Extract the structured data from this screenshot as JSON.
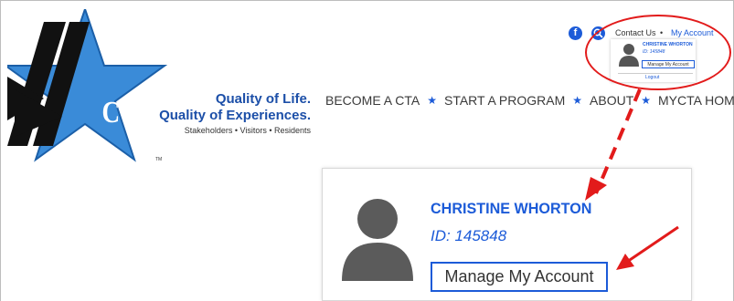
{
  "logo": {
    "text": "CTA",
    "tm": "TM",
    "tagline_line1": "Quality of Life.",
    "tagline_line2": "Quality of Experiences.",
    "tagline_line3": "Stakeholders • Visitors • Residents"
  },
  "nav": {
    "items": [
      "BECOME A CTA",
      "START A PROGRAM",
      "ABOUT",
      "MYCTA HOME"
    ],
    "separator": "★"
  },
  "social": {
    "facebook_icon": "facebook-icon",
    "search_icon": "search-icon"
  },
  "top_links": {
    "contact": "Contact Us",
    "separator": "•",
    "my_account": "My Account"
  },
  "account": {
    "name": "CHRISTINE WHORTON",
    "id": "ID: 145848",
    "manage_label": "Manage My Account",
    "logout_label": "Logout"
  },
  "colors": {
    "brand_blue": "#1c5bd8",
    "annotation_red": "#e21b1b"
  }
}
